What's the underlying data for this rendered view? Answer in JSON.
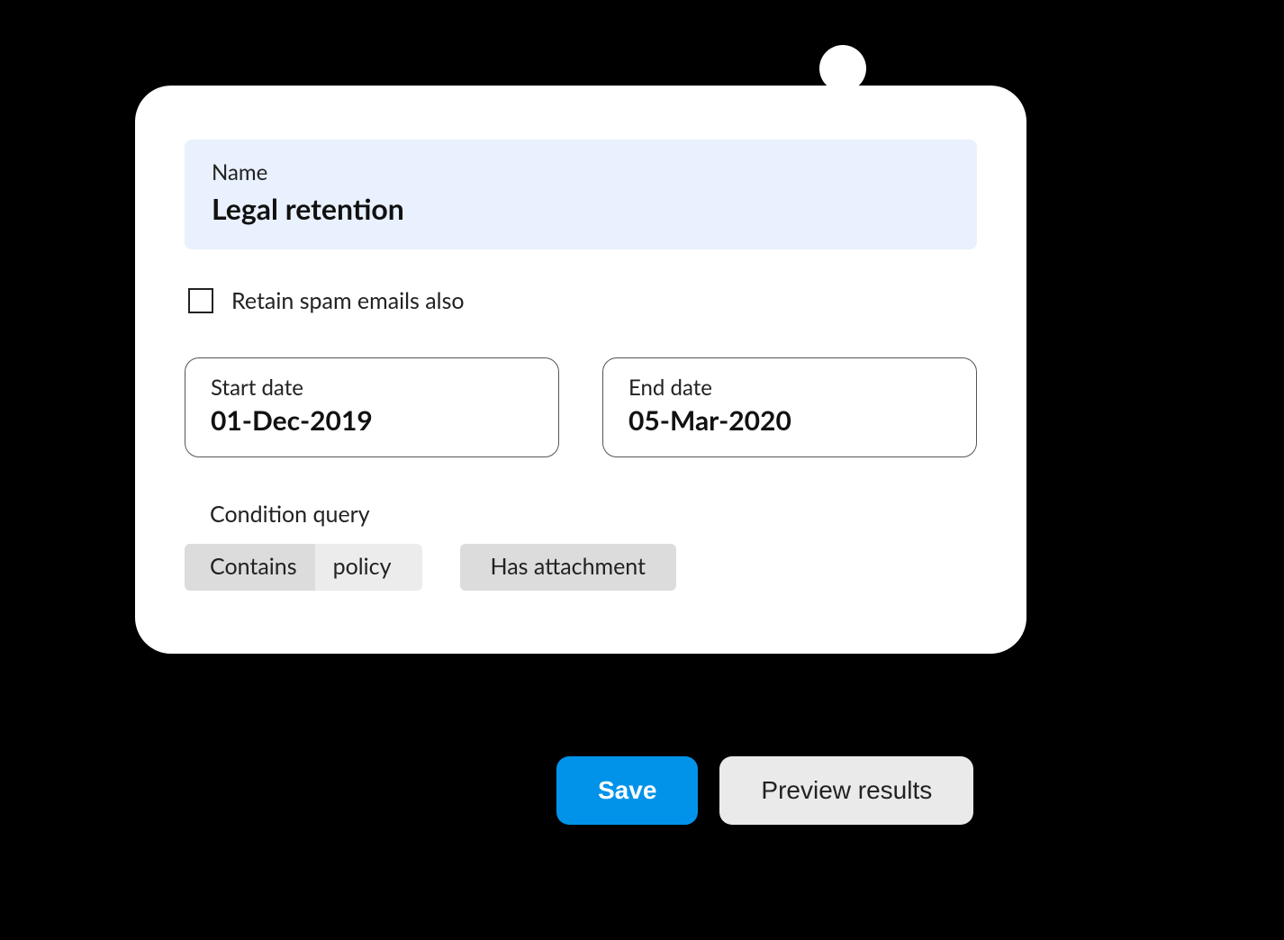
{
  "form": {
    "name": {
      "label": "Name",
      "value": "Legal retention"
    },
    "retain_spam": {
      "label": "Retain spam emails also",
      "checked": false
    },
    "start_date": {
      "label": "Start date",
      "value": "01-Dec-2019"
    },
    "end_date": {
      "label": "End date",
      "value": "05-Mar-2020"
    },
    "condition": {
      "label": "Condition query",
      "chips": [
        {
          "operator": "Contains",
          "value": "policy"
        },
        {
          "operator": "Has attachment"
        }
      ]
    }
  },
  "buttons": {
    "save": "Save",
    "preview": "Preview results"
  },
  "colors": {
    "primary": "#0093e9",
    "name_field_bg": "#e8f1fd",
    "chip_dark": "#dcdcdc",
    "chip_light": "#ececec",
    "btn_secondary_bg": "#eaeaea"
  }
}
